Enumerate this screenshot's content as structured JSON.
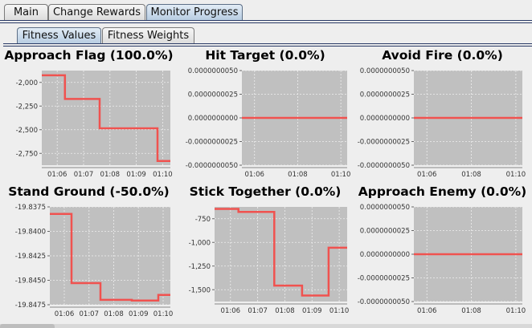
{
  "main_tabs": [
    {
      "label": "Main",
      "active": false
    },
    {
      "label": "Change Rewards",
      "active": false
    },
    {
      "label": "Monitor Progress",
      "active": true
    }
  ],
  "sub_tabs": [
    {
      "label": "Fitness Values",
      "active": true
    },
    {
      "label": "Fitness Weights",
      "active": false
    }
  ],
  "colors": {
    "series": "#f0524f",
    "plot_bg": "#c0c0c0",
    "accent": "#b8cde2"
  },
  "chart_data": [
    {
      "type": "line",
      "title": "Approach Flag (100.0%)",
      "x": [
        "01:06",
        "01:07",
        "01:08",
        "01:09",
        "01:10"
      ],
      "yticks": [
        "-2,000",
        "-2,250",
        "-2,500",
        "-2,750"
      ],
      "steps": [
        [
          0,
          -1950
        ],
        [
          0.18,
          -1950
        ],
        [
          0.18,
          -2200
        ],
        [
          0.45,
          -2200
        ],
        [
          0.45,
          -2510
        ],
        [
          0.9,
          -2510
        ],
        [
          0.9,
          -2855
        ],
        [
          1,
          -2855
        ]
      ],
      "ylim": [
        -2900,
        -1900
      ],
      "grid": true
    },
    {
      "type": "line",
      "title": "Hit Target (0.0%)",
      "x": [
        "01:06",
        "01:08",
        "01:10"
      ],
      "yticks": [
        "0.0000000050",
        "0.0000000025",
        "0.0000000000",
        "-0.0000000025",
        "-0.0000000050"
      ],
      "steps": [
        [
          0,
          0
        ],
        [
          1,
          0
        ]
      ],
      "ylim": [
        -5e-09,
        5e-09
      ],
      "grid": true
    },
    {
      "type": "line",
      "title": "Avoid Fire (0.0%)",
      "x": [
        "01:06",
        "01:08",
        "01:10"
      ],
      "yticks": [
        "0.0000000050",
        "0.0000000025",
        "0.0000000000",
        "-0.0000000025",
        "-0.0000000050"
      ],
      "steps": [
        [
          0,
          0
        ],
        [
          1,
          0
        ]
      ],
      "ylim": [
        -5e-09,
        5e-09
      ],
      "grid": true
    },
    {
      "type": "line",
      "title": "Stand Ground (-50.0%)",
      "x": [
        "01:06",
        "01:07",
        "01:08",
        "01:09",
        "01:10"
      ],
      "yticks": [
        "-19.8375",
        "-19.8400",
        "-19.8425",
        "-19.8450",
        "-19.8475"
      ],
      "steps": [
        [
          0,
          -19.8365
        ],
        [
          0.18,
          -19.8365
        ],
        [
          0.18,
          -19.8464
        ],
        [
          0.42,
          -19.8464
        ],
        [
          0.42,
          -19.8488
        ],
        [
          0.68,
          -19.8488
        ],
        [
          0.68,
          -19.8489
        ],
        [
          0.9,
          -19.8489
        ],
        [
          0.9,
          -19.8481
        ],
        [
          1,
          -19.8481
        ]
      ],
      "ylim": [
        -19.8495,
        -19.8355
      ],
      "grid": true
    },
    {
      "type": "line",
      "title": "Stick Together (0.0%)",
      "x": [
        "01:06",
        "01:07",
        "01:08",
        "01:09",
        "01:10"
      ],
      "yticks": [
        "-750",
        "-1,000",
        "-1,250",
        "-1,500"
      ],
      "steps": [
        [
          0,
          -600
        ],
        [
          0.18,
          -600
        ],
        [
          0.18,
          -630
        ],
        [
          0.45,
          -630
        ],
        [
          0.45,
          -1370
        ],
        [
          0.66,
          -1370
        ],
        [
          0.66,
          -1470
        ],
        [
          0.86,
          -1470
        ],
        [
          0.86,
          -990
        ],
        [
          1,
          -990
        ]
      ],
      "ylim": [
        -1530,
        -580
      ],
      "grid": true
    },
    {
      "type": "line",
      "title": "Approach Enemy (0.0%)",
      "x": [
        "01:06",
        "01:08",
        "01:10"
      ],
      "yticks": [
        "0.0000000050",
        "0.0000000025",
        "0.0000000000",
        "-0.0000000025",
        "-0.0000000050"
      ],
      "steps": [
        [
          0,
          0
        ],
        [
          1,
          0
        ]
      ],
      "ylim": [
        -5e-09,
        5e-09
      ],
      "grid": true
    }
  ]
}
